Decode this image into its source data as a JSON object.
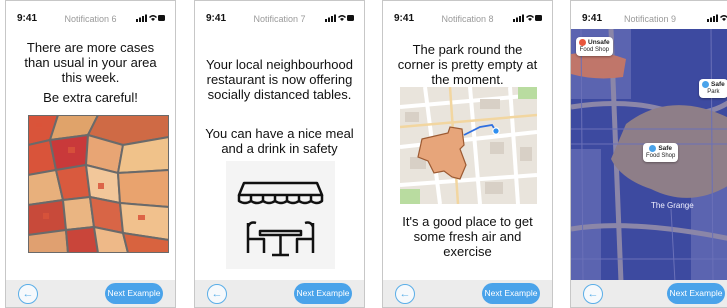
{
  "screens": [
    {
      "time": "9:41",
      "notification": "Notification 6",
      "lines": [
        "There are more cases than usual in your area this week.",
        "Be extra careful!"
      ],
      "next_label": "Next Example",
      "back_icon": "arrow-left-icon"
    },
    {
      "time": "9:41",
      "notification": "Notification 7",
      "lines": [
        "Your local neighbourhood restaurant is now offering socially distanced tables.",
        "You can have a nice meal and a drink in safety"
      ],
      "next_label": "Next Example",
      "back_icon": "arrow-left-icon"
    },
    {
      "time": "9:41",
      "notification": "Notification 8",
      "lines": [
        "The park round the corner is pretty empty at the moment.",
        "It's a good place to get some fresh air and exercise"
      ],
      "next_label": "Next Example",
      "back_icon": "arrow-left-icon"
    },
    {
      "time": "9:41",
      "notification": "Notification 9",
      "pins": [
        {
          "status": "Unsafe",
          "place": "Food Shop",
          "color": "#e8563c"
        },
        {
          "status": "Safe",
          "place": "Park",
          "color": "#4aa3ea"
        },
        {
          "status": "Safe",
          "place": "Food Shop",
          "color": "#4aa3ea"
        }
      ],
      "area_label": "The Grange",
      "next_label": "Next Example",
      "back_icon": "arrow-left-icon"
    }
  ],
  "colors": {
    "accent": "#4aa3ea",
    "unsafe": "#e8563c",
    "safe": "#4aa3ea",
    "footer": "#ececec"
  }
}
